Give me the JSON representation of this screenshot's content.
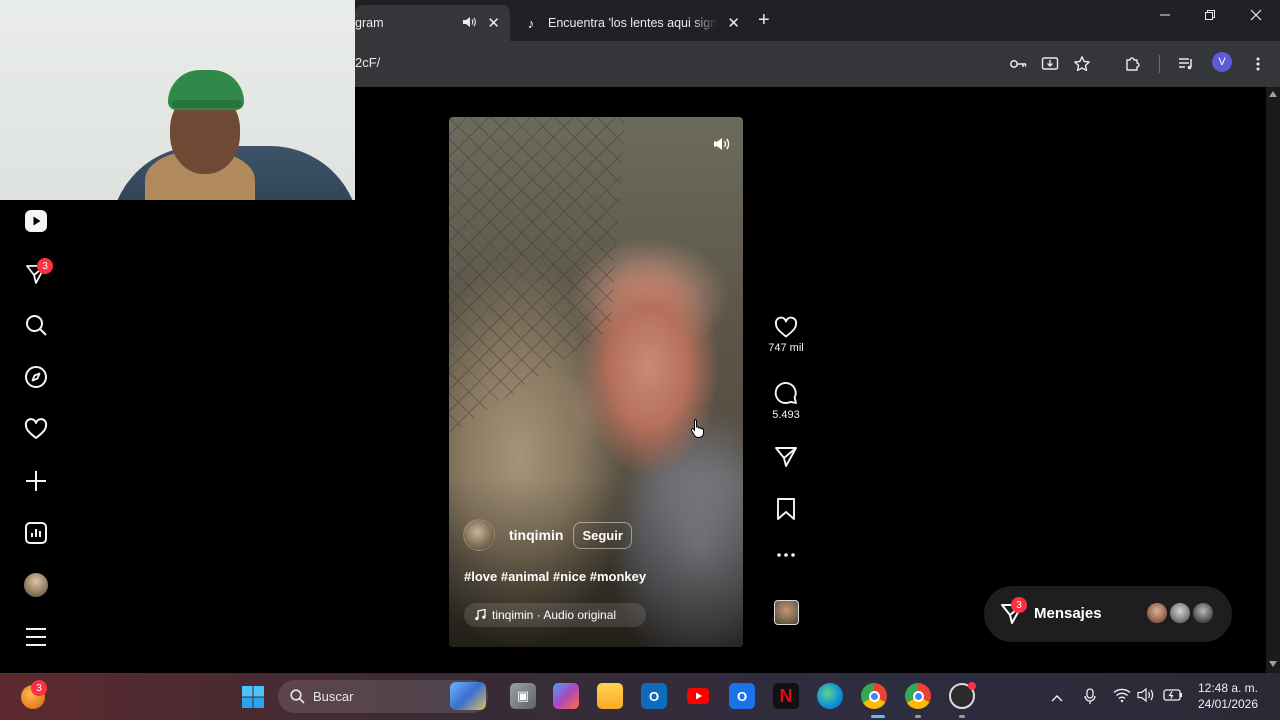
{
  "browser": {
    "active_tab": {
      "title": "gram"
    },
    "inactive_tab": {
      "title": "Encuentra 'los lentes aqui signif"
    },
    "url_fragment": "2cF/",
    "profile_initial": "V"
  },
  "sidebar": {
    "notifications_badge": "3"
  },
  "reel": {
    "author": "tinqimin",
    "follow_label": "Seguir",
    "caption": "#love #animal #nice #monkey",
    "audio": "tinqimin · Audio original"
  },
  "actions": {
    "likes": "747 mil",
    "comments": "5.493"
  },
  "messages": {
    "label": "Mensajes",
    "badge": "3"
  },
  "taskbar": {
    "search_placeholder": "Buscar",
    "weather_badge": "3",
    "time": "12:48 a. m.",
    "date": "24/01/2026"
  },
  "colors": {
    "badge_red": "#ff3040",
    "page_bg": "#000000",
    "chrome_dark": "#202124",
    "chrome_toolbar": "#35363a"
  }
}
